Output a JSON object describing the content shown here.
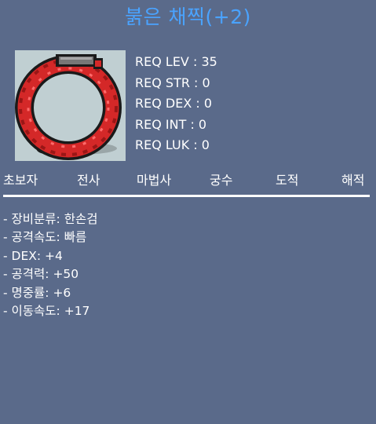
{
  "item": {
    "name": "붉은 채찍(+2)",
    "name_color": "#4aa3ff",
    "icon": "red-whip-icon"
  },
  "requirements": [
    "REQ LEV : 35",
    "REQ STR : 0",
    "REQ DEX : 0",
    "REQ INT : 0",
    "REQ LUK : 0"
  ],
  "jobs": [
    "초보자",
    "전사",
    "마법사",
    "궁수",
    "도적",
    "해적"
  ],
  "stats": [
    "- 장비분류: 한손검",
    "- 공격속도: 빠름",
    "- DEX: +4",
    "- 공격력: +50",
    "- 명중률: +6",
    "- 이동속도: +17"
  ],
  "colors": {
    "background": "#5a6a8a",
    "icon_background": "#c0cfd2",
    "whip_red": "#d42828",
    "handle_gray": "#777777"
  }
}
